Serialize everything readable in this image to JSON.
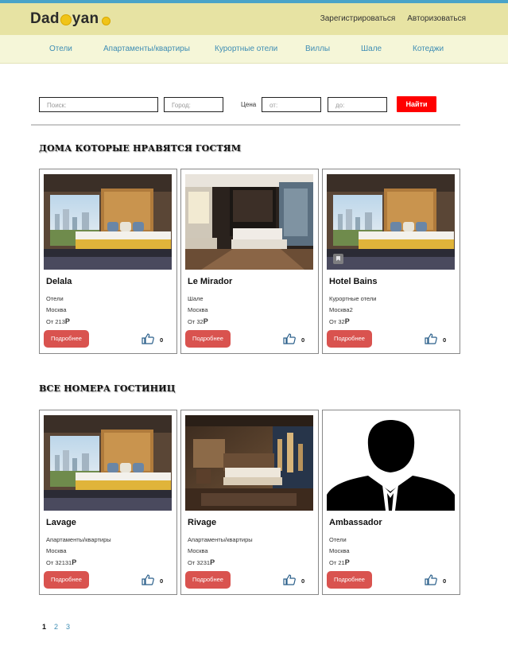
{
  "brand": {
    "logo_left": "Dad",
    "logo_right": "yan"
  },
  "auth": {
    "register": "Зарегистрироваться",
    "login": "Авторизоваться"
  },
  "nav": [
    "Отели",
    "Апартаменты/квартиры",
    "Курортные отели",
    "Виллы",
    "Шале",
    "Котеджи"
  ],
  "search": {
    "query_placeholder": "Поиск:",
    "city_placeholder": "Город:",
    "price_label": "Цена",
    "from_placeholder": "от:",
    "to_placeholder": "до:",
    "submit_label": "Найти"
  },
  "sections": {
    "popular_title": "ДОМА КОТОРЫЕ НРАВЯТСЯ ГОСТЯМ",
    "all_title": "ВСЕ НОМЕРА ГОСТИНИЦ"
  },
  "popular": [
    {
      "name": "Delala",
      "type": "Отели",
      "city": "Москва",
      "price_prefix": "От",
      "price": "213",
      "currency": "Р",
      "more": "Подробнее",
      "likes": "0",
      "photo": "hotel-room-city-view"
    },
    {
      "name": "Le Mirador",
      "type": "Шале",
      "city": "Москва",
      "price_prefix": "От",
      "price": "32",
      "currency": "Р",
      "more": "Подробнее",
      "likes": "0",
      "photo": "hotel-room-dark-suite"
    },
    {
      "name": "Hotel Bains",
      "type": "Курортные отели",
      "city": "Москва2",
      "price_prefix": "От",
      "price": "32",
      "currency": "Р",
      "more": "Подробнее",
      "likes": "0",
      "photo": "hotel-room-city-view"
    }
  ],
  "all_rooms": [
    {
      "name": "Lavage",
      "type": "Апартаменты/квартиры",
      "city": "Москва",
      "price_prefix": "От",
      "price": "32131",
      "currency": "Р",
      "more": "Подробнее",
      "likes": "0",
      "photo": "hotel-room-city-view"
    },
    {
      "name": "Rivage",
      "type": "Апартаменты/квартиры",
      "city": "Москва",
      "price_prefix": "От",
      "price": "3231",
      "currency": "Р",
      "more": "Подробнее",
      "likes": "0",
      "photo": "hotel-room-warm-night"
    },
    {
      "name": "Ambassador",
      "type": "Отели",
      "city": "Москва",
      "price_prefix": "От",
      "price": "21",
      "currency": "Р",
      "more": "Подробнее",
      "likes": "0",
      "photo": "person-silhouette-placeholder"
    }
  ],
  "pagination": [
    "1",
    "2",
    "3"
  ],
  "colors": {
    "header": "#e7e3a3",
    "nav": "#f5f6d8",
    "nav_link": "#3e8db4",
    "find_button": "#ff0000",
    "more_button": "#d9534f",
    "accent_stripe": "#4aa3c8"
  }
}
